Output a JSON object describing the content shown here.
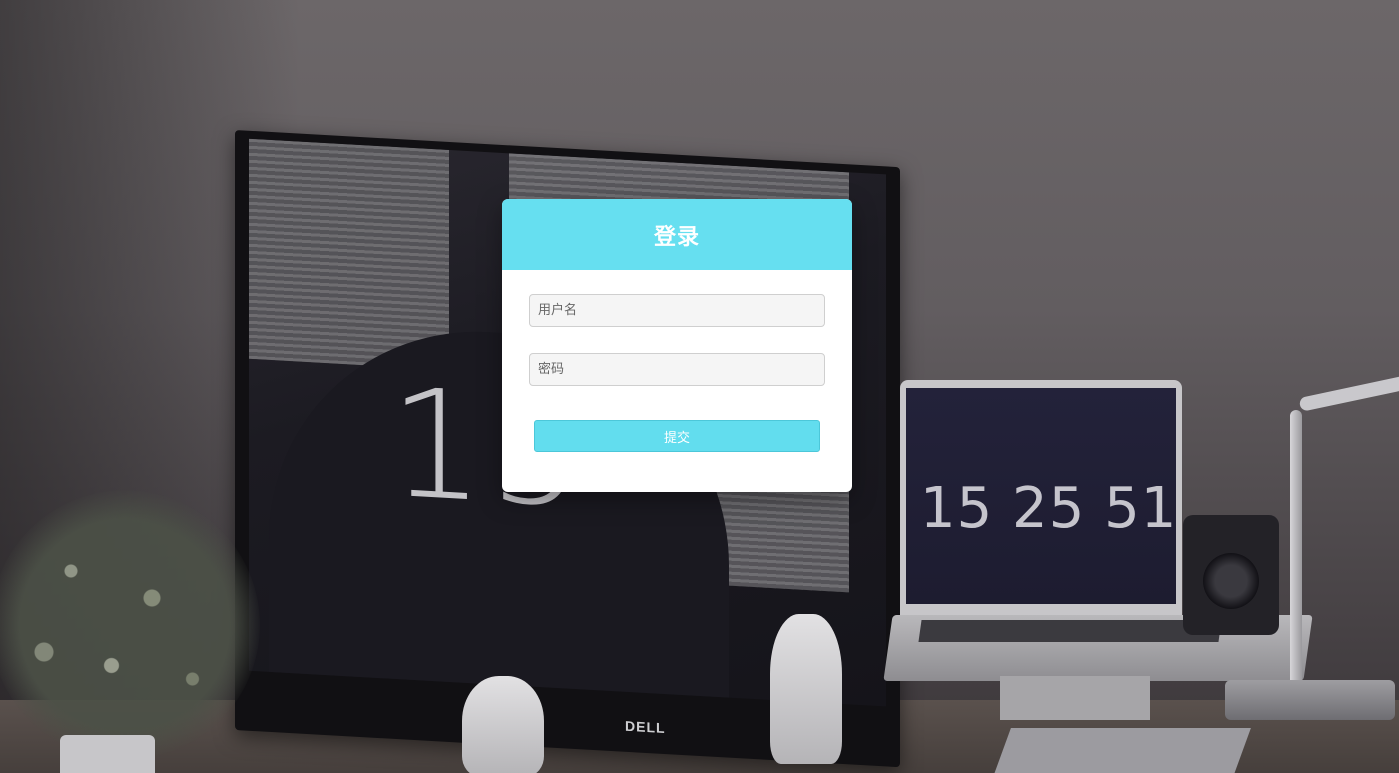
{
  "login": {
    "title": "登录",
    "username_placeholder": "用户名",
    "username_value": "",
    "password_placeholder": "密码",
    "password_value": "",
    "submit_label": "提交"
  },
  "background": {
    "monitor_clock": "15",
    "laptop_clock": "15 25 51",
    "monitor_brand": "DELL"
  },
  "colors": {
    "accent": "#66dff0",
    "button": "#62ddee",
    "card": "#ffffff",
    "input_bg": "#f5f5f5"
  }
}
